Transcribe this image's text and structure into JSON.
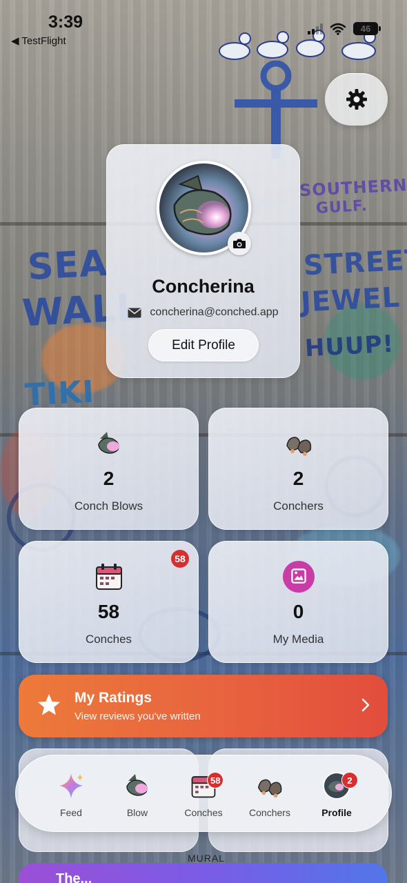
{
  "status_bar": {
    "time": "3:39",
    "back_label": "◀ TestFlight",
    "battery": "46"
  },
  "background_graffiti": [
    "SOUTHERN.",
    "GULF.",
    "SEA",
    "WALL",
    "STREET",
    "JEWEL",
    "HUUP!",
    "TIKI"
  ],
  "settings": {
    "icon": "gear-icon"
  },
  "profile": {
    "name": "Concherina",
    "email": "concherina@conched.app",
    "edit_label": "Edit Profile",
    "avatar_icon": "conch-shell-avatar",
    "camera_icon": "camera-icon",
    "mail_icon": "envelope-icon"
  },
  "stats": [
    {
      "value": "2",
      "label": "Conch Blows",
      "icon": "conch-shell-icon"
    },
    {
      "value": "2",
      "label": "Conchers",
      "icon": "hermit-crabs-icon"
    },
    {
      "value": "58",
      "label": "Conches",
      "icon": "calendar-icon",
      "badge": "58"
    },
    {
      "value": "0",
      "label": "My Media",
      "icon": "photo-gallery-icon"
    }
  ],
  "ratings": {
    "title": "My Ratings",
    "subtitle": "View reviews you've written",
    "icon": "star-icon"
  },
  "peek": {
    "mural": "MURAL",
    "next_title": "The..."
  },
  "tabs": [
    {
      "label": "Feed",
      "icon": "sparkle-icon"
    },
    {
      "label": "Blow",
      "icon": "conch-shell-icon"
    },
    {
      "label": "Conches",
      "icon": "calendar-icon",
      "badge": "58"
    },
    {
      "label": "Conchers",
      "icon": "hermit-crabs-icon"
    },
    {
      "label": "Profile",
      "icon": "avatar-icon",
      "badge": "2",
      "active": true
    }
  ],
  "colors": {
    "accent_orange": "#e8633f",
    "badge_red": "#d62f2f",
    "media_pink": "#c93ca6"
  }
}
